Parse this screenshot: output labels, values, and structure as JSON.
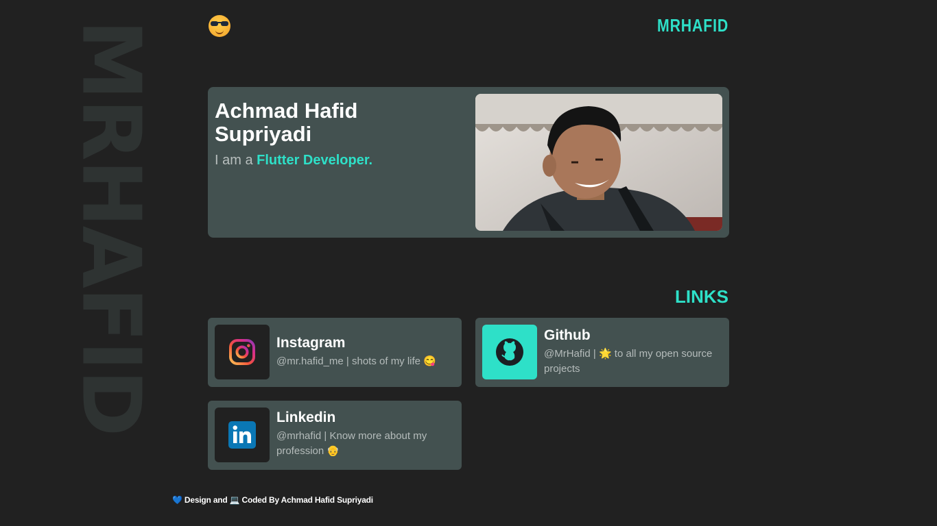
{
  "watermark": {
    "text": "MRHAFID"
  },
  "header": {
    "emoji_icon": "smiling-face-with-sunglasses",
    "brand": "MRHAFID"
  },
  "hero": {
    "name": "Achmad Hafid Supriyadi",
    "role_prefix": "I am a",
    "role_highlight": "Flutter Developer."
  },
  "links": {
    "title": "LINKS",
    "items": [
      {
        "title": "Instagram",
        "description": "@mr.hafid_me | shots of my life 😋",
        "icon": "instagram-icon"
      },
      {
        "title": "Github",
        "description": "@MrHafid | 🌟 to all my open source projects",
        "icon": "github-icon"
      },
      {
        "title": "Linkedin",
        "description": "@mrhafid | Know more about my profession 👴",
        "icon": "linkedin-icon"
      }
    ]
  },
  "footer": {
    "text": "💙 Design and 💻 Coded By Achmad Hafid Supriyadi"
  },
  "colors": {
    "background": "#212121",
    "card": "#435150",
    "accent": "#2ee0c8",
    "watermark": "#2e3332"
  }
}
